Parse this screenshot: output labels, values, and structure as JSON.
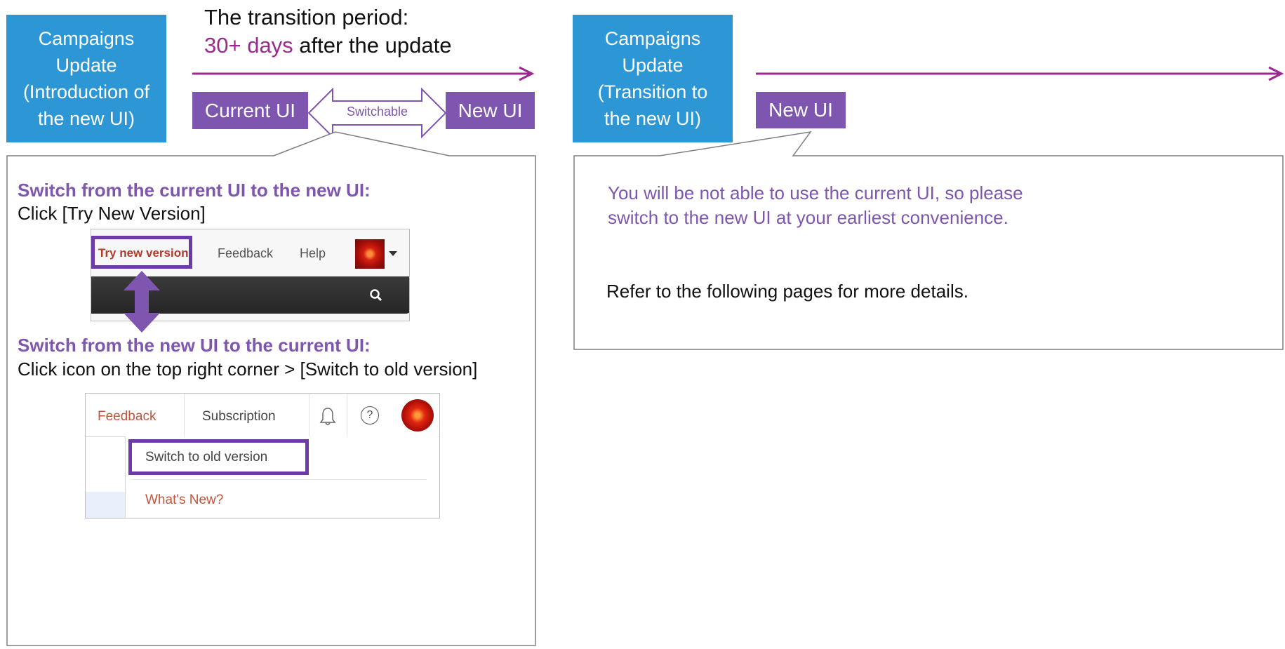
{
  "left": {
    "update_box": {
      "lines": [
        "Campaigns",
        "Update",
        "(Introduction of",
        "the new UI)"
      ]
    },
    "period": {
      "line1": "The transition period:",
      "highlight": "30+ days",
      "rest": " after the update"
    },
    "current_ui": "Current UI",
    "switchable": "Switchable",
    "new_ui": "New UI",
    "callout": {
      "heading1": "Switch from the current UI to the new UI:",
      "text1": "Click [Try New Version]",
      "screenshot1": {
        "try_new": "Try new version",
        "feedback": "Feedback",
        "help": "Help"
      },
      "heading2": "Switch from the new UI to the current UI:",
      "text2": "Click icon on the top right corner > [Switch to old version]",
      "screenshot2": {
        "feedback": "Feedback",
        "subscription": "Subscription",
        "help_glyph": "?",
        "switch_old": "Switch to old version",
        "whats_new": "What's New?"
      }
    }
  },
  "right": {
    "update_box": {
      "lines": [
        "Campaigns",
        "Update",
        "(Transition to",
        "the new UI)"
      ]
    },
    "new_ui": "New UI",
    "callout": {
      "line1": "You will be not able to use the current UI, so please",
      "line2": "switch to the new UI at your earliest convenience.",
      "refer": "Refer to the following pages for more details."
    }
  },
  "colors": {
    "blue": "#2D97D6",
    "purple": "#7E56AF",
    "magenta": "#9B2A8E",
    "arrow": "#9B2A8E"
  }
}
